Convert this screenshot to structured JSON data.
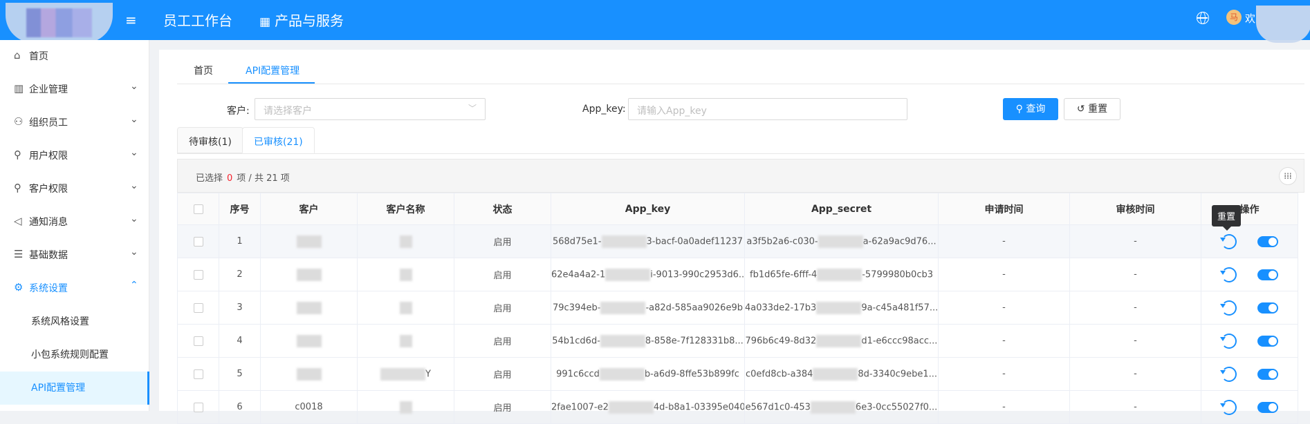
{
  "header": {
    "nav": [
      {
        "label": "员工工作台",
        "icon": "none"
      },
      {
        "label": "产品与服务",
        "icon": "apps-grid-icon"
      }
    ],
    "avatar_text": "马",
    "welcome": "欢"
  },
  "sidebar": {
    "items": [
      {
        "label": "首页",
        "icon": "home-icon",
        "has_children": false
      },
      {
        "label": "企业管理",
        "icon": "building-icon",
        "has_children": true
      },
      {
        "label": "组织员工",
        "icon": "team-icon",
        "has_children": true
      },
      {
        "label": "用户权限",
        "icon": "user-key-icon",
        "has_children": true
      },
      {
        "label": "客户权限",
        "icon": "customer-key-icon",
        "has_children": true
      },
      {
        "label": "通知消息",
        "icon": "speaker-icon",
        "has_children": true
      },
      {
        "label": "基础数据",
        "icon": "database-icon",
        "has_children": true
      },
      {
        "label": "系统设置",
        "icon": "gear-icon",
        "has_children": true,
        "expanded": true
      }
    ],
    "sub_items": [
      {
        "label": "系统风格设置"
      },
      {
        "label": "小包系统规则配置"
      },
      {
        "label": "API配置管理",
        "active": true
      }
    ]
  },
  "page_tabs": [
    {
      "label": "首页"
    },
    {
      "label": "API配置管理",
      "active": true
    }
  ],
  "filters": {
    "customer_label": "客户:",
    "customer_placeholder": "请选择客户",
    "appkey_label": "App_key:",
    "appkey_placeholder": "请输入App_key",
    "search_button": "查询",
    "reset_button": "重置"
  },
  "status_tabs": [
    {
      "label": "待审核(1)"
    },
    {
      "label": "已审核(21)",
      "active": true
    }
  ],
  "selection": {
    "prefix": "已选择",
    "count": "0",
    "suffix": "项 / 共 21 项"
  },
  "table": {
    "columns": [
      "序号",
      "客户",
      "客户名称",
      "状态",
      "App_key",
      "App_secret",
      "申请时间",
      "审核时间",
      "操作"
    ],
    "rows": [
      {
        "no": "1",
        "status": "启用",
        "key_a": "568d75e1-",
        "key_b": "3-bacf-0a0adef11237",
        "sec_a": "a3f5b2a6-c030-",
        "sec_b": "a-62a9ac9d76...",
        "apply": "-",
        "review": "-"
      },
      {
        "no": "2",
        "status": "启用",
        "key_a": "62e4a4a2-1",
        "key_b": "i-9013-990c2953d6...",
        "sec_a": "fb1d65fe-6fff-4",
        "sec_b": "-5799980b0cb3",
        "apply": "-",
        "review": "-"
      },
      {
        "no": "3",
        "status": "启用",
        "key_a": "79c394eb-",
        "key_b": "-a82d-585aa9026e9b",
        "sec_a": "4a033de2-17b3",
        "sec_b": "9a-c45a481f57...",
        "apply": "-",
        "review": "-"
      },
      {
        "no": "4",
        "status": "启用",
        "key_a": "54b1cd6d-",
        "key_b": "8-858e-7f128331b8...",
        "sec_a": "796b6c49-8d32",
        "sec_b": "d1-e6ccc98acc...",
        "apply": "-",
        "review": "-"
      },
      {
        "no": "5",
        "status": "启用",
        "key_a": "991c6ccd",
        "key_b": "b-a6d9-8ffe53b899fc",
        "sec_a": "c0efd8cb-a384",
        "sec_b": "8d-3340c9ebe1...",
        "apply": "-",
        "review": "-",
        "name_tail": "Y"
      },
      {
        "no": "6",
        "status": "启用",
        "key_a": "2fae1007-e2",
        "key_b": "4d-b8a1-03395e0406...",
        "sec_a": "e567d1c0-453",
        "sec_b": "6e3-0cc55027f0...",
        "apply": "-",
        "review": "-",
        "cust_tail": "c0018"
      }
    ]
  },
  "tooltip": "重置",
  "colors": {
    "primary": "#1890ff",
    "danger": "#f5222d",
    "sidebar_active_bg": "#e6f7ff"
  }
}
